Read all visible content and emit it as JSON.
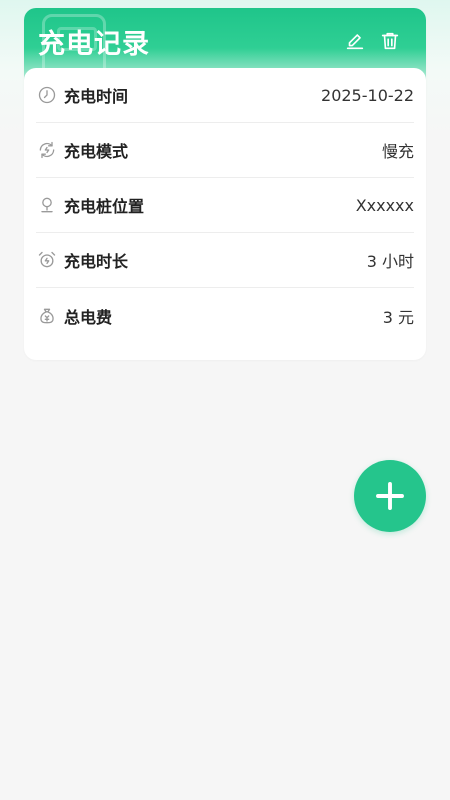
{
  "header": {
    "title": "充电记录",
    "actions": [
      {
        "name": "edit",
        "icon": "pencil-icon"
      },
      {
        "name": "delete",
        "icon": "trash-icon"
      }
    ],
    "accent_color": "#1fc58a"
  },
  "record": {
    "rows": [
      {
        "label": "充电时间",
        "value": "2025-10-22",
        "icon": "clock-icon"
      },
      {
        "label": "充电模式",
        "value": "慢充",
        "icon": "refresh-icon"
      },
      {
        "label": "充电桩位置",
        "value": "Xxxxxx",
        "icon": "location-pin-icon"
      },
      {
        "label": "充电时长",
        "value": "3 小时",
        "icon": "alarm-clock-icon"
      },
      {
        "label": "总电费",
        "value": "3 元",
        "icon": "money-bag-icon"
      }
    ]
  },
  "fab": {
    "icon": "plus-icon",
    "color": "#25c58c"
  }
}
